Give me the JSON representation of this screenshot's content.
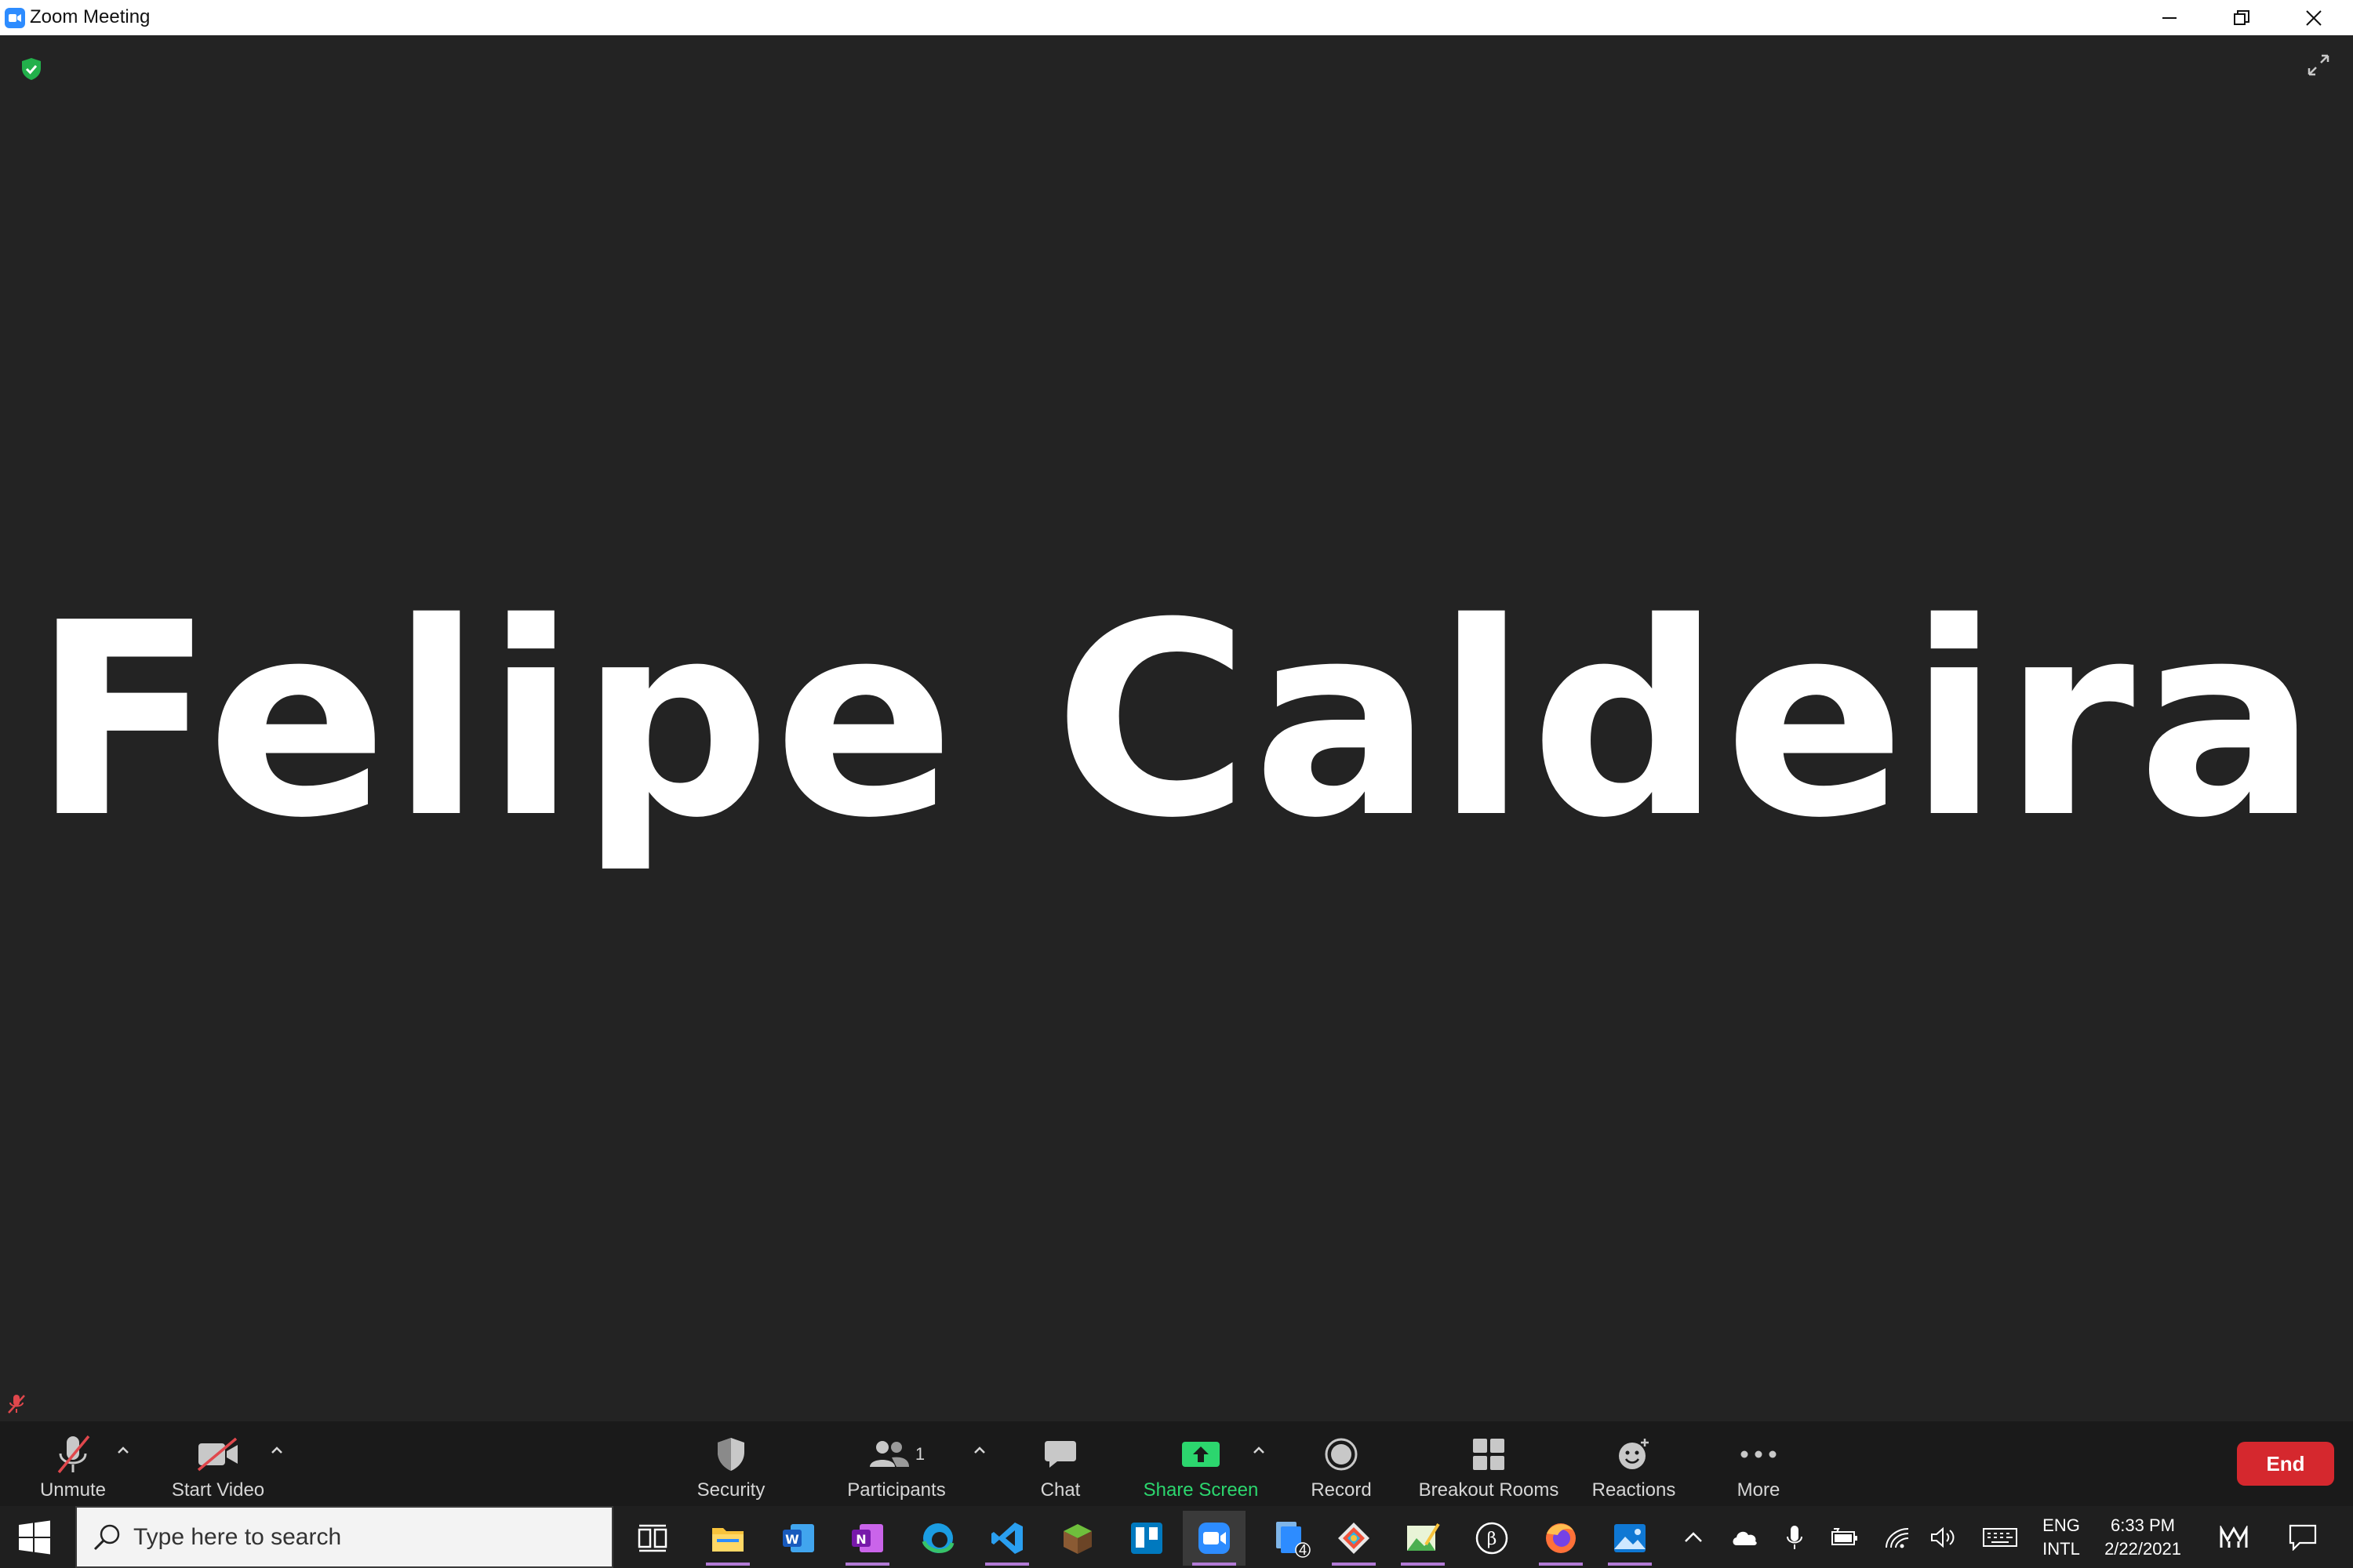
{
  "window": {
    "title": "Zoom Meeting"
  },
  "meeting": {
    "participant_name": "Felipe Caldeira"
  },
  "toolbar": {
    "unmute_label": "Unmute",
    "start_video_label": "Start Video",
    "security_label": "Security",
    "participants_label": "Participants",
    "participants_count": "1",
    "chat_label": "Chat",
    "share_screen_label": "Share Screen",
    "record_label": "Record",
    "breakout_rooms_label": "Breakout Rooms",
    "reactions_label": "Reactions",
    "more_label": "More",
    "end_label": "End"
  },
  "taskbar": {
    "search_placeholder": "Type here to search",
    "language_line1": "ENG",
    "language_line2": "INTL",
    "time": "6:33 PM",
    "date": "2/22/2021",
    "files_badge": "4"
  },
  "colors": {
    "meeting_bg": "#232323",
    "toolbar_bg": "#1a1a1a",
    "share_green": "#2cd66e",
    "end_red": "#d5282e",
    "zoom_blue": "#2d8cff"
  }
}
